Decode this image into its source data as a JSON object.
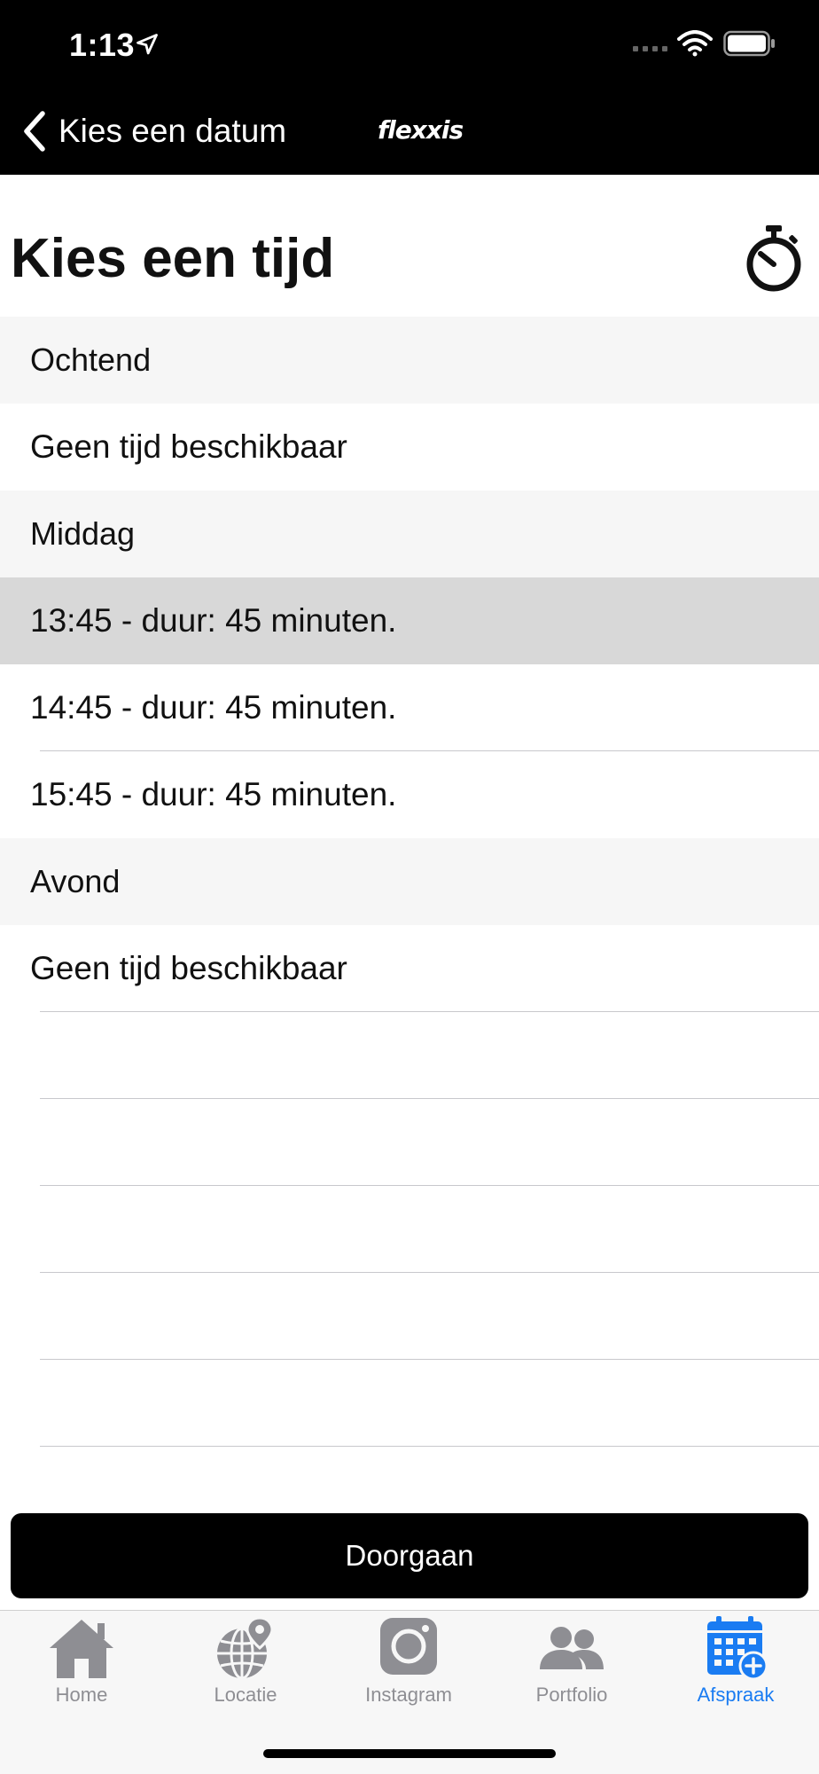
{
  "status_bar": {
    "time": "1:13",
    "icons": [
      "location-arrow-icon",
      "signal-icon",
      "wifi-icon",
      "battery-icon"
    ]
  },
  "nav": {
    "back_label": "Kies een datum",
    "logo_text": "flexxis",
    "back_icon": "chevron-left-icon"
  },
  "page": {
    "title": "Kies een tijd",
    "title_icon": "stopwatch-icon"
  },
  "sections": [
    {
      "header": "Ochtend",
      "rows": [
        "Geen tijd beschikbaar"
      ]
    },
    {
      "header": "Middag",
      "rows": [
        "13:45 - duur: 45 minuten.",
        "14:45 - duur: 45 minuten.",
        "15:45 - duur: 45 minuten."
      ],
      "selected_index": 0
    },
    {
      "header": "Avond",
      "rows": [
        "Geen tijd beschikbaar"
      ]
    }
  ],
  "continue_label": "Doorgaan",
  "tabs": [
    {
      "label": "Home",
      "icon": "home-icon",
      "active": false
    },
    {
      "label": "Locatie",
      "icon": "globe-location-icon",
      "active": false
    },
    {
      "label": "Instagram",
      "icon": "instagram-icon",
      "active": false
    },
    {
      "label": "Portfolio",
      "icon": "people-icon",
      "active": false
    },
    {
      "label": "Afspraak",
      "icon": "calendar-add-icon",
      "active": true
    }
  ],
  "colors": {
    "accent": "#1a7cf2",
    "inactive_tab": "#8e8e93",
    "header_bg": "#000000",
    "section_bg": "#f6f6f6",
    "selected_row_bg": "#d8d8d8"
  }
}
